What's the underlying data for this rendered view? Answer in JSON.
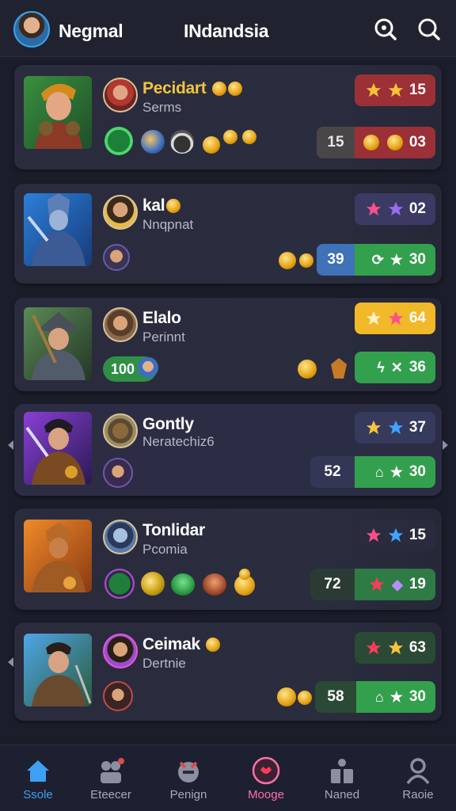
{
  "header": {
    "username": "Negmal",
    "region": "INdandsia",
    "icons": [
      "help-search-icon",
      "search-icon"
    ]
  },
  "cards": [
    {
      "name": "Pecidart",
      "subtitle": "Serms",
      "rating": "15",
      "score_left": "15",
      "score_right": "03",
      "name_color": "#f3c33e",
      "rating_bg": "#9b3037",
      "score_left_bg": "#4a4648",
      "score_right_bg": "#9b3037"
    },
    {
      "name": "kal",
      "subtitle": "Nnqpnat",
      "rating": "02",
      "score_left": "39",
      "score_right": "30",
      "rating_bg": "#3b3a63",
      "score_left_bg": "#3f72b7",
      "score_right_bg": "#33a04d"
    },
    {
      "name": "Elalo",
      "subtitle": "Perinnt",
      "badge": "100",
      "rating": "64",
      "score_right": "36",
      "rating_bg": "#f1b829",
      "score_right_bg": "#33a04d"
    },
    {
      "name": "Gontly",
      "subtitle": "Neratechiz6",
      "rating": "37",
      "score_left": "52",
      "score_right": "30",
      "rating_bg": "#363a5c",
      "score_left_bg": "#343656",
      "score_right_bg": "#33a04d"
    },
    {
      "name": "Tonlidar",
      "subtitle": "Pcomia",
      "rating": "15",
      "score_left": "72",
      "score_right": "19",
      "rating_bg": "#2a2c3d",
      "score_left_bg": "#2b3b34",
      "score_right_bg": "#2e7b45"
    },
    {
      "name": "Ceimak",
      "subtitle": "Dertnie",
      "rating": "63",
      "score_left": "58",
      "score_right": "30",
      "rating_bg": "#2a4a35",
      "score_left_bg": "#2b4a36",
      "score_right_bg": "#33a04d"
    }
  ],
  "nav": [
    {
      "label": "Ssole",
      "icon": "home-icon"
    },
    {
      "label": "Eteecer",
      "icon": "team-icon"
    },
    {
      "label": "Penign",
      "icon": "character-icon"
    },
    {
      "label": "Mooge",
      "icon": "hero-icon"
    },
    {
      "label": "Naned",
      "icon": "shop-icon"
    },
    {
      "label": "Raoie",
      "icon": "profile-icon"
    }
  ]
}
